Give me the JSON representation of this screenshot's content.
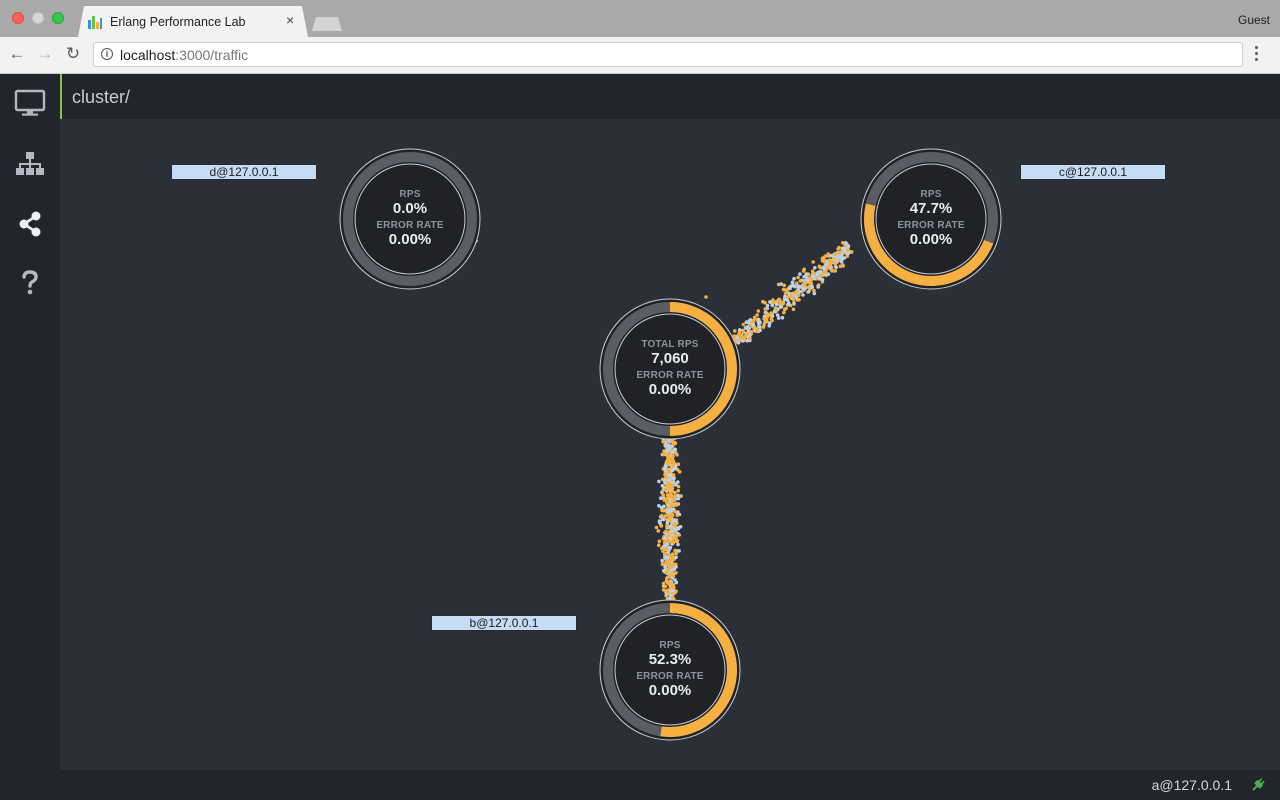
{
  "browser": {
    "tab_title": "Erlang Performance Lab",
    "profile": "Guest",
    "url_host": "localhost",
    "url_path": ":3000/traffic"
  },
  "sidebar": {
    "items": [
      {
        "icon": "monitor-icon",
        "active": false
      },
      {
        "icon": "sitemap-icon",
        "active": false
      },
      {
        "icon": "share-icon",
        "active": true
      },
      {
        "icon": "help-icon",
        "active": false
      }
    ]
  },
  "header": {
    "breadcrumb": "cluster/"
  },
  "nodes": {
    "center": {
      "rps_label": "TOTAL RPS",
      "rps_value": "7,060",
      "err_label": "ERROR RATE",
      "err_value": "0.00%",
      "share": 0.5
    },
    "d": {
      "name": "d@127.0.0.1",
      "rps_label": "RPS",
      "rps_value": "0.0%",
      "err_label": "ERROR RATE",
      "err_value": "0.00%",
      "share": 0.0
    },
    "c": {
      "name": "c@127.0.0.1",
      "rps_label": "RPS",
      "rps_value": "47.7%",
      "err_label": "ERROR RATE",
      "err_value": "0.00%",
      "share": 0.477
    },
    "b": {
      "name": "b@127.0.0.1",
      "rps_label": "RPS",
      "rps_value": "52.3%",
      "err_label": "ERROR RATE",
      "err_value": "0.00%",
      "share": 0.523
    }
  },
  "colors": {
    "accent": "#f5b041",
    "request_dot": "#f5b041",
    "response_dot": "#b9d3ea",
    "ring_track": "#5a5d63",
    "node_fill": "#202226",
    "active_border": "#8bc34a"
  },
  "statusbar": {
    "node": "a@127.0.0.1",
    "connection": "connected"
  }
}
